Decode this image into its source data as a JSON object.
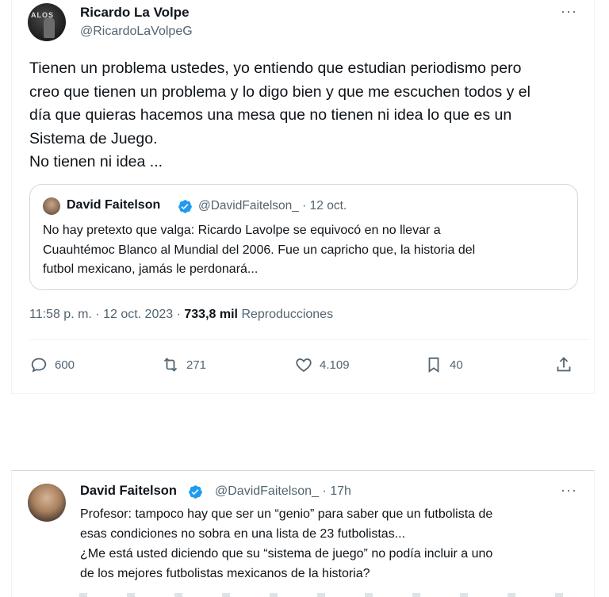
{
  "tweet": {
    "author_name": "Ricardo La Volpe",
    "author_handle": "@RicardoLaVolpeG",
    "avatar_text": "ALOS",
    "more": "···",
    "body_lines": [
      "Tienen un problema ustedes, yo entiendo que estudian periodismo pero",
      "creo que tienen un problema y lo digo bien y que me escuchen todos y el",
      "día que quieras hacemos una mesa que no tienen ni idea lo que es un",
      "Sistema de Juego.",
      "No tienen ni idea ..."
    ],
    "timestamp_text": "11:58 p. m. · 12 oct. 2023 · ",
    "views_count": "733,8 mil",
    "views_label": "Reproducciones",
    "actions": {
      "replies": "600",
      "retweets": "271",
      "likes": "4.109",
      "bookmarks": "40"
    }
  },
  "quote": {
    "author_name": "David Faitelson",
    "meta": "@DavidFaitelson_ · 12 oct.",
    "body_lines": [
      "No hay pretexto que valga: Ricardo Lavolpe se equivocó en no llevar a",
      "Cuauhtémoc Blanco al Mundial del 2006. Fue un capricho que, la historia del",
      "futbol mexicano, jamás le perdonará..."
    ]
  },
  "reply": {
    "author_name": "David Faitelson",
    "meta": "@DavidFaitelson_ · 17h",
    "more": "···",
    "body_lines": [
      "Profesor: tampoco hay que ser un “genio” para saber que un futbolista de",
      "esas condiciones no sobra en una lista de 23 futbolistas...",
      "¿Me está usted diciendo que su “sistema de juego” no podía incluir a uno",
      "de los mejores futbolistas mexicanos de la historia?"
    ]
  },
  "colors": {
    "verified": "#1d9bf0",
    "secondary_text": "#536471",
    "primary_text": "#0f1419"
  }
}
